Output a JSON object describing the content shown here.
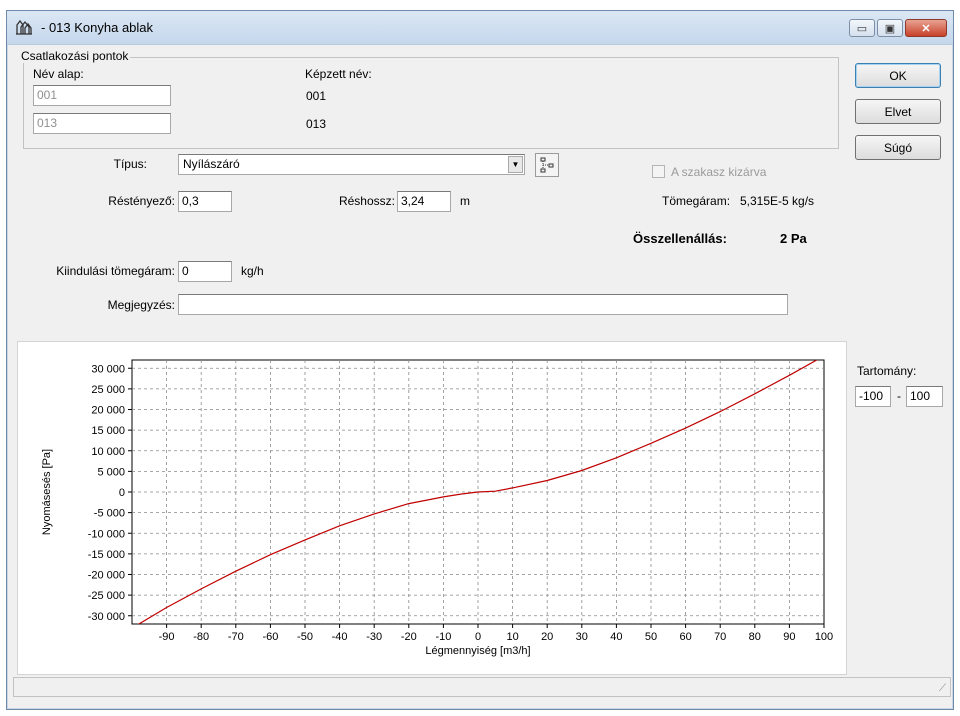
{
  "window": {
    "title": "- 013 Konyha ablak",
    "minimize": "▭",
    "maximize": "▣",
    "close": "✕"
  },
  "connection": {
    "title": "Csatlakozási pontok",
    "base_name_label": "Név alap:",
    "formed_name_label": "Képzett név:",
    "base1": "001",
    "base2": "013",
    "formed1": "001",
    "formed2": "013"
  },
  "buttons": {
    "ok": "OK",
    "cancel": "Elvet",
    "help": "Súgó"
  },
  "form": {
    "type_label": "Típus:",
    "type_value": "Nyílászáró",
    "excluded_label": "A szakasz kizárva",
    "resistance_label": "Réstényező:",
    "resistance_value": "0,3",
    "gap_length_label": "Réshossz:",
    "gap_length_value": "3,24",
    "gap_length_unit": "m",
    "massflow_label": "Tömegáram:",
    "massflow_value": "5,315E-5 kg/s",
    "total_resistance_label": "Összellenállás:",
    "total_resistance_value": "2 Pa",
    "initial_massflow_label": "Kiindulási tömegáram:",
    "initial_massflow_value": "0",
    "initial_massflow_unit": "kg/h",
    "note_label": "Megjegyzés:",
    "note_value": ""
  },
  "range": {
    "label": "Tartomány:",
    "min": "-100",
    "separator": "-",
    "max": "100"
  },
  "chart_data": {
    "type": "line",
    "xlabel": "Légmennyiség [m3/h]",
    "ylabel": "Nyomásesés [Pa]",
    "xlim": [
      -100,
      100
    ],
    "ylim": [
      -32000,
      32000
    ],
    "x_ticks": [
      -90,
      -80,
      -70,
      -60,
      -50,
      -40,
      -30,
      -20,
      -10,
      0,
      10,
      20,
      30,
      40,
      50,
      60,
      70,
      80,
      90,
      100
    ],
    "y_ticks": [
      30000,
      25000,
      20000,
      15000,
      10000,
      5000,
      0,
      -5000,
      -10000,
      -15000,
      -20000,
      -25000,
      -30000
    ],
    "y_tick_labels": [
      "30 000",
      "25 000",
      "20 000",
      "15 000",
      "10 000",
      "5 000",
      "0",
      "-5 000",
      "-10 000",
      "-15 000",
      "-20 000",
      "-25 000",
      "-30 000"
    ],
    "grid": true,
    "line_color": "#c00000",
    "series": [
      {
        "x": [
          -100,
          -90,
          -80,
          -70,
          -60,
          -50,
          -40,
          -30,
          -20,
          -10,
          -5,
          0,
          5,
          10,
          20,
          30,
          40,
          50,
          60,
          70,
          80,
          90,
          100
        ],
        "values": [
          -33000,
          -28000,
          -23500,
          -19200,
          -15200,
          -11600,
          -8200,
          -5300,
          -2800,
          -1200,
          -500,
          0,
          200,
          1000,
          2800,
          5200,
          8300,
          11800,
          15500,
          19500,
          23800,
          28300,
          33000
        ]
      }
    ]
  }
}
